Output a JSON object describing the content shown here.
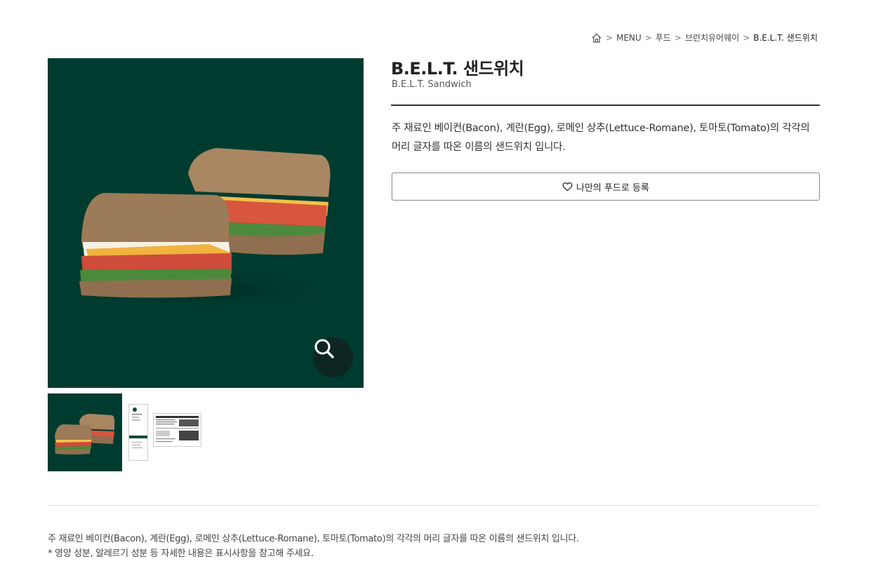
{
  "breadcrumb": {
    "home_icon": "home-icon",
    "items": [
      "MENU",
      "푸드",
      "브런치유어웨이"
    ],
    "current": "B.E.L.T. 샌드위치"
  },
  "product": {
    "title": "B.E.L.T. 샌드위치",
    "subtitle": "B.E.L.T. Sandwich",
    "description": "주 재료인 베이컨(Bacon), 계란(Egg), 로메인 상추(Lettuce-Romane), 토마토(Tomato)의 각각의 머리 글자를 따온 이름의 샌드위치 입니다.",
    "favorite_label": "나만의 푸드로 등록",
    "favorite_icon": "heart-outline-icon",
    "zoom_icon": "search-icon",
    "image_bg": "#003b30"
  },
  "details": {
    "line1": "주 재료인 베이컨(Bacon), 계란(Egg), 로메인 상추(Lettuce-Romane), 토마토(Tomato)의 각각의 머리 글자를 따온 이름의 샌드위치 입니다.",
    "line2": "* 영양 성분, 알레르기 성분 등 자세한 내용은 표시사항을 참고해 주세요."
  }
}
